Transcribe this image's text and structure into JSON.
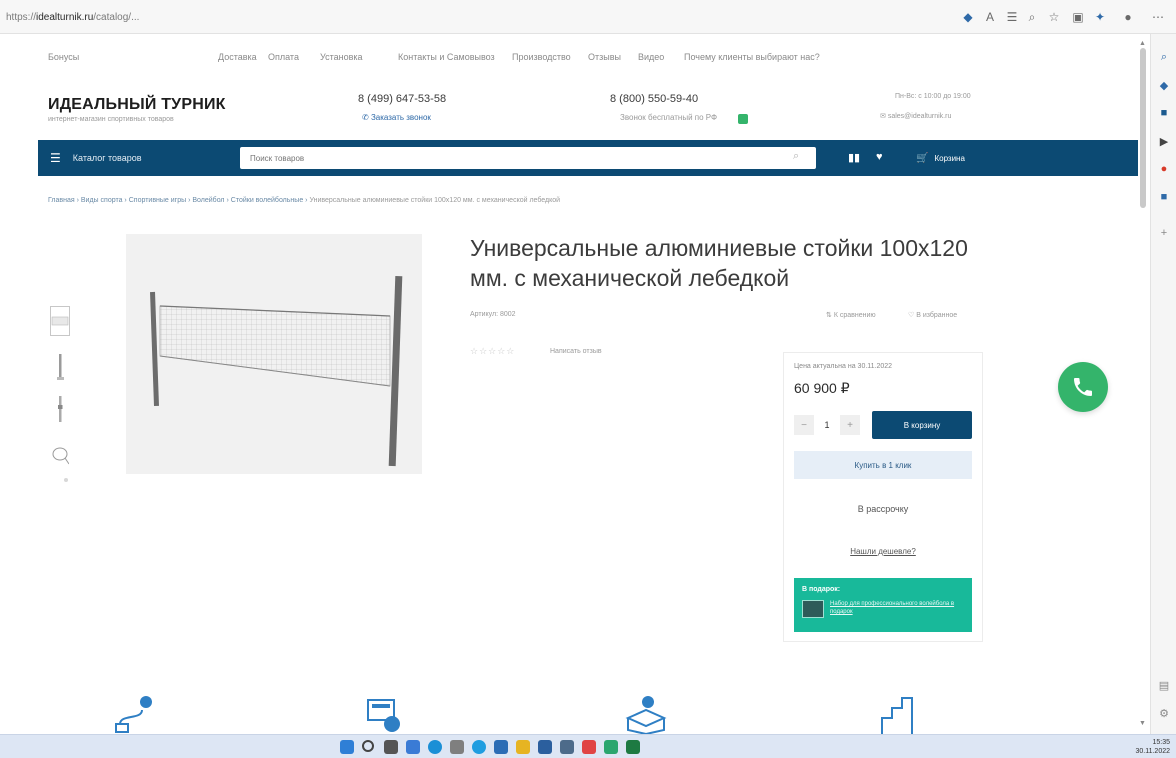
{
  "browser": {
    "url_prefix": "https://",
    "url_domain": "idealturnik.ru",
    "url_path": "/catalog/..."
  },
  "topmenu": {
    "items": [
      "Бонусы",
      "Доставка",
      "Оплата",
      "Установка",
      "Контакты и Самовывоз",
      "Производство",
      "Отзывы",
      "Видео",
      "Почему клиенты выбирают нас?"
    ]
  },
  "header": {
    "logo_title": "ИДЕАЛЬНЫЙ ТУРНИК",
    "logo_subtitle": "интернет-магазин спортивных товаров",
    "phone1": "8 (499) 647-53-58",
    "phone1_link": "Заказать звонок",
    "phone2": "8 (800) 550-59-40",
    "phone2_note": "Звонок бесплатный по РФ",
    "hours": "Пн-Вс: с 10:00 до 19:00",
    "email": "sales@idealturnik.ru"
  },
  "navbar": {
    "catalog_label": "Каталог товаров",
    "search_placeholder": "Поиск товаров",
    "cart_label": "Корзина"
  },
  "breadcrumb": {
    "items": [
      "Главная",
      "Виды спорта",
      "Спортивные игры",
      "Волейбол",
      "Стойки волейбольные"
    ],
    "current": "Универсальные алюминиевые стойки 100х120 мм. с механической лебедкой"
  },
  "product": {
    "title": "Универсальные алюминиевые стойки 100х120 мм. с механической лебедкой",
    "article": "Артикул: 8002",
    "compare": "К сравнению",
    "favorites": "В избранное",
    "stars": "☆☆☆☆☆",
    "reviews": "Написать отзыв"
  },
  "buybox": {
    "price_date": "Цена актуальна на 30.11.2022",
    "price": "60 900 ₽",
    "qty": "1",
    "add_to_cart": "В корзину",
    "one_click": "Купить в 1 клик",
    "installment": "В рассрочку",
    "found_cheaper": "Нашли дешевле?",
    "stock_title": "В подарок:",
    "stock_link": "Набор для профессионального волейбола в подарок"
  },
  "taskbar": {
    "time": "15:35",
    "date": "30.11.2022"
  }
}
